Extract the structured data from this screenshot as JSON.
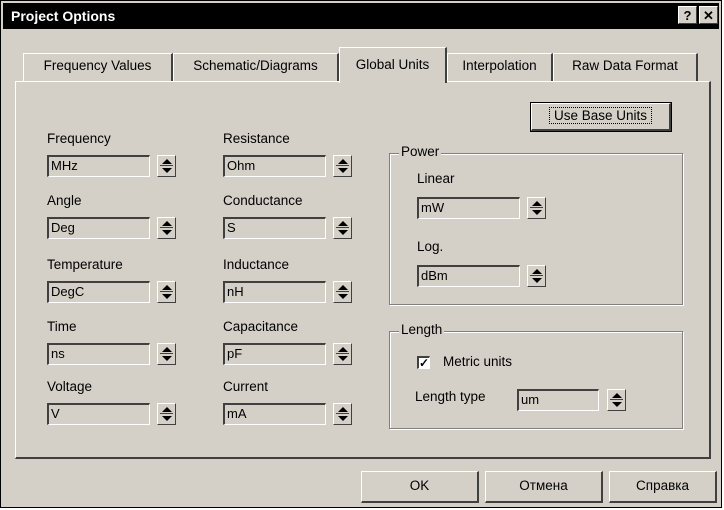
{
  "window": {
    "title": "Project Options",
    "help_glyph": "?",
    "close_glyph": "✕"
  },
  "tabs": [
    {
      "label": "Frequency Values"
    },
    {
      "label": "Schematic/Diagrams"
    },
    {
      "label": "Global Units",
      "active": true
    },
    {
      "label": "Interpolation"
    },
    {
      "label": "Raw Data Format"
    }
  ],
  "units": {
    "frequency": {
      "label": "Frequency",
      "value": "MHz"
    },
    "angle": {
      "label": "Angle",
      "value": "Deg"
    },
    "temperature": {
      "label": "Temperature",
      "value": "DegC"
    },
    "time": {
      "label": "Time",
      "value": "ns"
    },
    "voltage": {
      "label": "Voltage",
      "value": "V"
    },
    "resistance": {
      "label": "Resistance",
      "value": "Ohm"
    },
    "conductance": {
      "label": "Conductance",
      "value": "S"
    },
    "inductance": {
      "label": "Inductance",
      "value": "nH"
    },
    "capacitance": {
      "label": "Capacitance",
      "value": "pF"
    },
    "current": {
      "label": "Current",
      "value": "mA"
    }
  },
  "use_base_units_label": "Use Base Units",
  "power": {
    "title": "Power",
    "linear_label": "Linear",
    "linear_value": "mW",
    "log_label": "Log.",
    "log_value": "dBm"
  },
  "length": {
    "title": "Length",
    "metric_label": "Metric units",
    "metric_checked": true,
    "type_label": "Length type",
    "type_value": "um"
  },
  "buttons": {
    "ok": "OK",
    "cancel": "Отмена",
    "help": "Справка"
  }
}
